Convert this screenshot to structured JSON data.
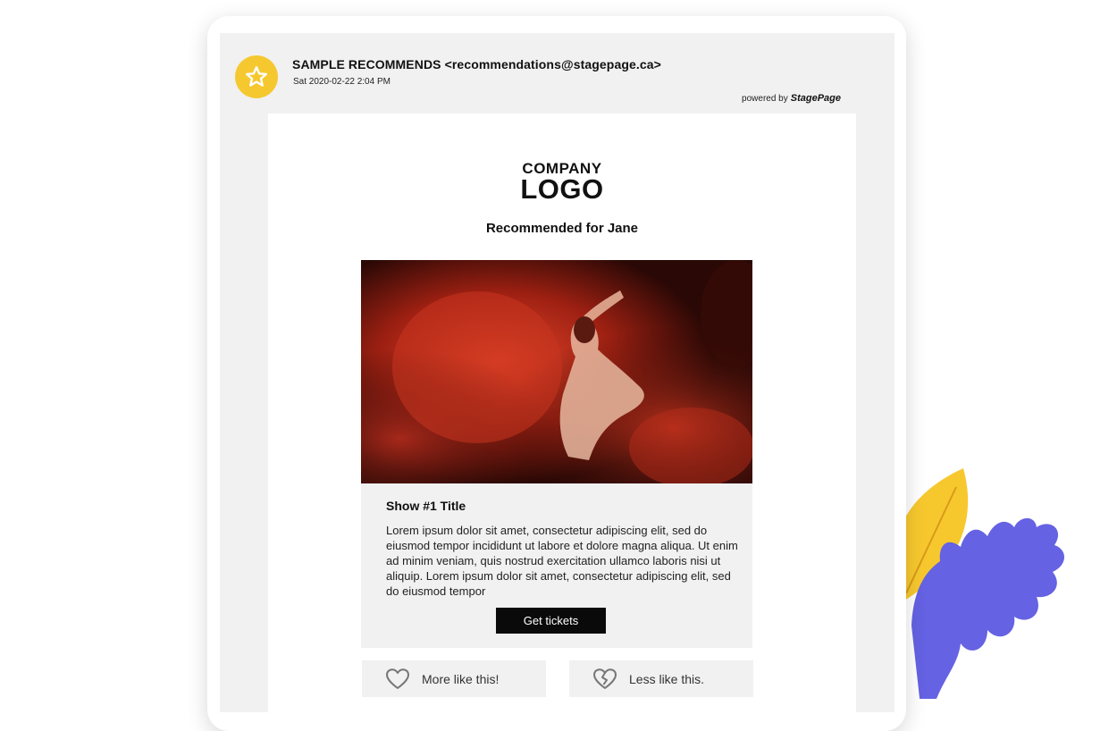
{
  "email": {
    "sender_name": "SAMPLE RECOMMENDS",
    "sender_address": "<recommendations@stagepage.ca>",
    "date": "Sat 2020-02-22 2:04 PM",
    "powered_by_label": "powered by",
    "powered_by_brand": "StagePage"
  },
  "body": {
    "logo_line1": "COMPANY",
    "logo_line2": "LOGO",
    "recommended_heading": "Recommended for Jane"
  },
  "show": {
    "title": "Show #1 Title",
    "description": "Lorem ipsum dolor sit amet, consectetur adipiscing elit, sed do eiusmod tempor incididunt ut labore et dolore magna aliqua. Ut enim ad minim veniam, quis nostrud exercitation ullamco laboris nisi ut aliquip. Lorem ipsum dolor sit amet, consectetur adipiscing elit, sed do eiusmod tempor",
    "cta_label": "Get tickets"
  },
  "feedback": {
    "more_label": "More like this!",
    "less_label": "Less like this."
  },
  "icons": {
    "avatar": "star-icon",
    "more": "heart-icon",
    "less": "broken-heart-icon"
  },
  "colors": {
    "avatar": "#f6c830",
    "leaf_yellow": "#f7c82e",
    "leaf_purple": "#6562e3",
    "button": "#0a0a0a",
    "panel": "#f0f1f0"
  }
}
